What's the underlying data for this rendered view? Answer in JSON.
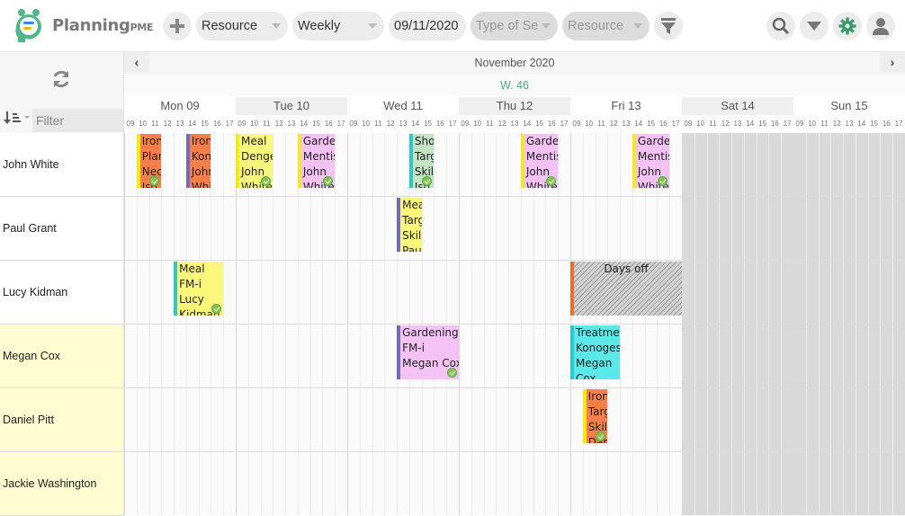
{
  "app": {
    "name": "Planning",
    "name_suffix": "PME"
  },
  "toolbar": {
    "add_label": "+",
    "view_select": "Resource",
    "period_select": "Weekly",
    "date": "09/11/2020",
    "type_filter_placeholder": "Type of Se",
    "resource_filter_placeholder": "Resource",
    "icons": [
      "plus-icon",
      "funnel-icon",
      "search-icon",
      "caret-down-icon",
      "gear-icon",
      "user-icon"
    ]
  },
  "sidebar": {
    "filter_placeholder": "Filter"
  },
  "calendar": {
    "month": "November 2020",
    "week": "W. 46",
    "days": [
      "Mon 09",
      "Tue 10",
      "Wed 11",
      "Thu 12",
      "Fri 13",
      "Sat 14",
      "Sun 15"
    ],
    "hours": [
      "09",
      "10",
      "11",
      "12",
      "13",
      "14",
      "15",
      "16",
      "17"
    ],
    "weekend_days": [
      5,
      6
    ]
  },
  "resources": [
    {
      "name": "John White",
      "highlight": false
    },
    {
      "name": "Paul Grant",
      "highlight": false
    },
    {
      "name": "Lucy Kidman",
      "highlight": false
    },
    {
      "name": "Megan Cox",
      "highlight": true
    },
    {
      "name": "Daniel Pitt",
      "highlight": true
    },
    {
      "name": "Jackie Washington",
      "highlight": true
    }
  ],
  "colors": {
    "orange": "#f97f4a",
    "yellow": "#fbf77a",
    "pink": "#f4c2f4",
    "green": "#c4e2c4",
    "cyan": "#5ae8e8",
    "bar_yellow": "#f7e81e",
    "bar_purple": "#6f6cc0",
    "bar_teal": "#2fc9c4",
    "bar_orange": "#e8702a",
    "accent": "#4caf7d",
    "highlight_row": "#fefdd2"
  },
  "events": [
    {
      "row": 0,
      "day": 0,
      "start": 1.0,
      "end": 3.0,
      "fill": "orange",
      "bar": "bar_yellow",
      "lines": [
        "Iron",
        "Plan",
        "Nec",
        "Iso"
      ],
      "done": true
    },
    {
      "row": 0,
      "day": 0,
      "start": 5.0,
      "end": 7.0,
      "fill": "orange",
      "bar": "bar_purple",
      "lines": [
        "Iron",
        "Kon",
        "John",
        "White"
      ],
      "done": false
    },
    {
      "row": 0,
      "day": 1,
      "start": 0.0,
      "end": 3.0,
      "fill": "yellow",
      "bar": "bar_yellow",
      "lines": [
        "Meal",
        "Denge",
        "John",
        "White"
      ],
      "done": true
    },
    {
      "row": 0,
      "day": 1,
      "start": 5.0,
      "end": 8.0,
      "fill": "pink",
      "bar": "bar_yellow",
      "lines": [
        "Garde",
        "Mentis",
        "John",
        "White"
      ],
      "done": true
    },
    {
      "row": 0,
      "day": 2,
      "start": 5.0,
      "end": 7.0,
      "fill": "green",
      "bar": "bar_teal",
      "lines": [
        "Sho",
        "Targ",
        "Skil",
        "Iso"
      ],
      "done": true
    },
    {
      "row": 0,
      "day": 3,
      "start": 5.0,
      "end": 8.0,
      "fill": "pink",
      "bar": "bar_yellow",
      "lines": [
        "Garde",
        "Mentis",
        "John",
        "White"
      ],
      "done": true
    },
    {
      "row": 0,
      "day": 4,
      "start": 5.0,
      "end": 8.0,
      "fill": "pink",
      "bar": "bar_yellow",
      "lines": [
        "Garde",
        "Mentis",
        "John",
        "White"
      ],
      "done": true
    },
    {
      "row": 1,
      "day": 2,
      "start": 4.0,
      "end": 6.0,
      "fill": "yellow",
      "bar": "bar_purple",
      "lines": [
        "Meal",
        "Targ",
        "Skil",
        "Paul"
      ],
      "done": false
    },
    {
      "row": 2,
      "day": 0,
      "start": 4.0,
      "end": 8.0,
      "fill": "yellow",
      "bar": "bar_teal",
      "lines": [
        "Meal",
        "FM-i",
        "Lucy",
        "Kidman"
      ],
      "done": true
    },
    {
      "row": 3,
      "day": 2,
      "start": 4.0,
      "end": 9.0,
      "fill": "pink",
      "bar": "bar_purple",
      "lines": [
        "Gardening",
        "FM-i",
        "Megan Cox"
      ],
      "done": true
    },
    {
      "row": 3,
      "day": 4,
      "start": 0.0,
      "end": 4.0,
      "fill": "cyan",
      "bar": "bar_teal",
      "lines": [
        "Treatment",
        "Konoges",
        "Megan",
        "Cox"
      ],
      "done": false
    },
    {
      "row": 4,
      "day": 4,
      "start": 1.0,
      "end": 3.0,
      "fill": "orange",
      "bar": "bar_yellow",
      "lines": [
        "Iron",
        "Targ",
        "Skil",
        "Daniel"
      ],
      "done": true
    }
  ],
  "days_off": [
    {
      "row": 2,
      "day": 4,
      "start": 0.0,
      "end": 9.0,
      "label": "Days off"
    }
  ]
}
